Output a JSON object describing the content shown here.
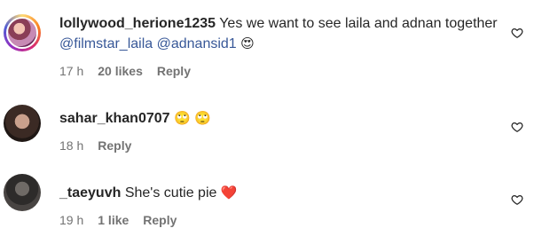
{
  "comments": [
    {
      "username": "lollywood_herione1235",
      "text_before": "Yes we want to see laila and adnan together ",
      "mentions": [
        "@filmstar_laila",
        "@adnansid1"
      ],
      "emoji": "😍",
      "time": "17 h",
      "likes": "20 likes",
      "reply_label": "Reply"
    },
    {
      "username": "sahar_khan0707",
      "emoji": "🙄 🙄",
      "time": "18 h",
      "reply_label": "Reply"
    },
    {
      "username": "_taeyuvh",
      "text": "She's cutie pie",
      "emoji": "❤️",
      "time": "19 h",
      "likes": "1 like",
      "reply_label": "Reply"
    }
  ],
  "icons": {
    "like": "heart-outline-icon"
  },
  "colors": {
    "text": "#262626",
    "meta": "#737373",
    "mention": "#385898",
    "heart_emoji": "#e0245e"
  }
}
